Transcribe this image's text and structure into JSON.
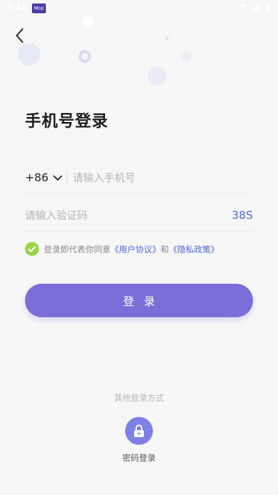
{
  "status_bar": {
    "time": "2:48",
    "app_badge": "Moji",
    "colors": {
      "text": "#ffffff"
    }
  },
  "nav": {
    "back_icon": "chevron-left-icon"
  },
  "page": {
    "title": "手机号登录"
  },
  "phone": {
    "country_code": "+86",
    "dropdown_icon": "chevron-down-icon",
    "placeholder": "请输入手机号",
    "value": ""
  },
  "code": {
    "placeholder": "请输入验证码",
    "value": "",
    "countdown": "38S"
  },
  "agreement": {
    "checked": true,
    "prefix": "登录即代表你同意",
    "user_agreement": "《用户协议》",
    "and": "和",
    "privacy_policy": "《隐私政策》"
  },
  "login_button": {
    "label": "登录"
  },
  "other_methods": {
    "title": "其他登录方式",
    "password_login": {
      "icon": "lock-icon",
      "label": "密码登录"
    }
  },
  "colors": {
    "accent": "#7b6ed8",
    "link": "#4a6ad8",
    "check": "#9ad34a",
    "lock_circle": "#7f80e4"
  }
}
